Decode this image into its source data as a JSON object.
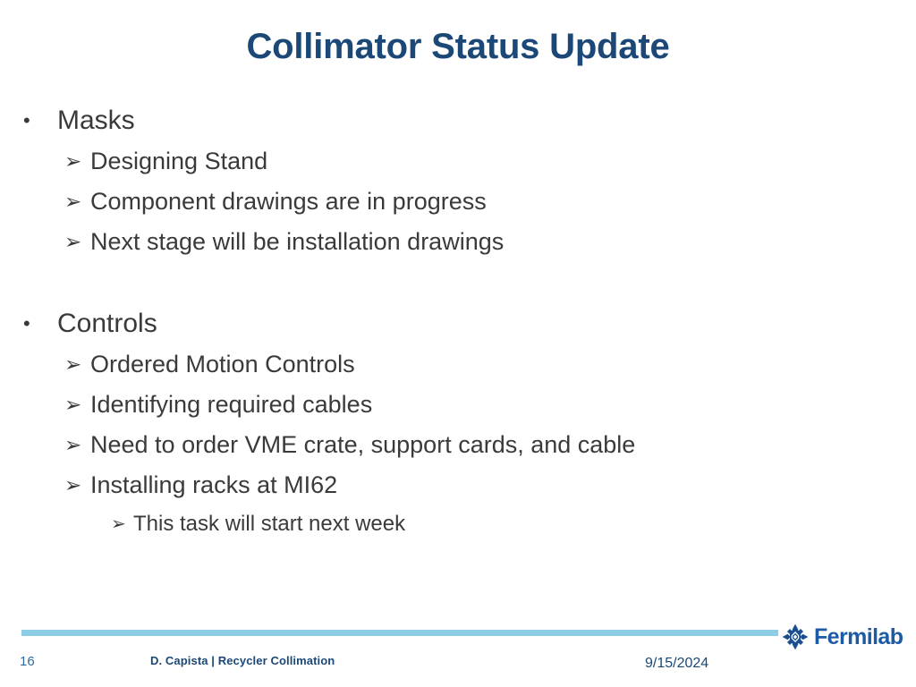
{
  "slide": {
    "title": "Collimator Status Update",
    "sections": [
      {
        "heading": "Masks",
        "marker": "•",
        "items": [
          {
            "text": "Designing Stand",
            "marker": "➢",
            "level": 2
          },
          {
            "text": "Component drawings are in progress",
            "marker": "➢",
            "level": 2
          },
          {
            "text": "Next stage will be installation drawings",
            "marker": "➢",
            "level": 2
          }
        ]
      },
      {
        "heading": "Controls",
        "marker": "•",
        "items": [
          {
            "text": "Ordered Motion Controls",
            "marker": "➢",
            "level": 2
          },
          {
            "text": "Identifying required cables",
            "marker": "➢",
            "level": 2
          },
          {
            "text": "Need to order VME crate, support cards, and cable",
            "marker": "➢",
            "level": 2
          },
          {
            "text": "Installing racks at MI62",
            "marker": "➢",
            "level": 2
          },
          {
            "text": "This task will start next week",
            "marker": "➢",
            "level": 3
          }
        ]
      }
    ]
  },
  "footer": {
    "page_number": "16",
    "author": "D. Capista | Recycler Collimation",
    "date": "9/15/2024",
    "logo_text": "Fermilab",
    "logo_icon": "fermilab-logo-icon"
  },
  "colors": {
    "title": "#1b4877",
    "body_text": "#3a3a3a",
    "rule": "#8ecde6",
    "page_number": "#2f6a9e",
    "footer_text": "#1b4877",
    "logo_blue": "#1c5ba3",
    "background": "#ffffff"
  }
}
